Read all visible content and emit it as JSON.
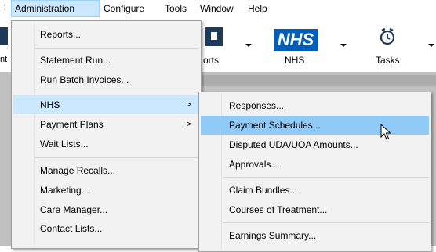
{
  "menubar": {
    "items": [
      {
        "label": "Administration"
      },
      {
        "label": "Configure"
      },
      {
        "label": "Tools"
      },
      {
        "label": "Window"
      },
      {
        "label": "Help"
      }
    ]
  },
  "toolbar": {
    "reports_partial": "orts",
    "nhs_logo": "NHS",
    "nhs_label": "NHS",
    "tasks_label": "Tasks",
    "left_partial": "nt"
  },
  "admin_menu": {
    "items": [
      {
        "label": "Reports..."
      },
      {
        "label": "Statement Run..."
      },
      {
        "label": "Run Batch Invoices..."
      },
      {
        "label": "NHS",
        "arrow": ">"
      },
      {
        "label": "Payment Plans",
        "arrow": ">"
      },
      {
        "label": "Wait Lists..."
      },
      {
        "label": "Manage Recalls..."
      },
      {
        "label": "Marketing..."
      },
      {
        "label": "Care Manager..."
      },
      {
        "label": "Contact Lists..."
      }
    ]
  },
  "nhs_submenu": {
    "items": [
      {
        "label": "Responses..."
      },
      {
        "label": "Payment Schedules..."
      },
      {
        "label": "Disputed UDA/UOA Amounts..."
      },
      {
        "label": "Approvals..."
      },
      {
        "label": "Claim Bundles..."
      },
      {
        "label": "Courses of Treatment..."
      },
      {
        "label": "Earnings Summary..."
      }
    ]
  },
  "colors": {
    "highlight": "#91c9f7",
    "menubar_active": "#cce8ff",
    "nhs_blue": "#005eb8"
  }
}
